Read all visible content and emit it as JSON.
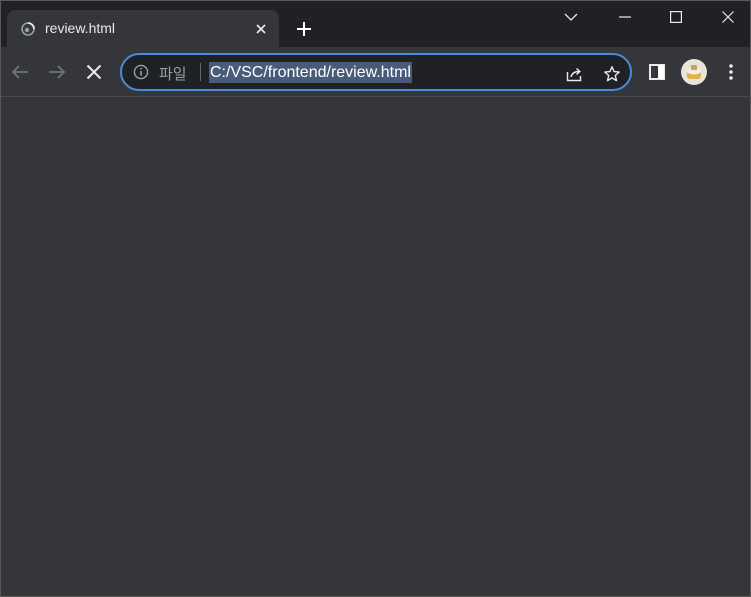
{
  "tab": {
    "title": "review.html",
    "favicon": "loading-globe-icon"
  },
  "window_controls": {
    "tab_search": "chevron-down-icon",
    "minimize": "minimize-icon",
    "maximize": "maximize-icon",
    "close": "close-icon"
  },
  "toolbar": {
    "back": "arrow-left-icon",
    "forward": "arrow-right-icon",
    "stop": "stop-loading-icon"
  },
  "omnibox": {
    "chip_label": "파일",
    "url": "C:/VSC/frontend/review.html",
    "focus_color": "#4a8ad9",
    "selection_color": "#4a5b7a"
  },
  "colors": {
    "frame": "#202124",
    "toolbar": "#35363a",
    "content": "#35363a"
  }
}
